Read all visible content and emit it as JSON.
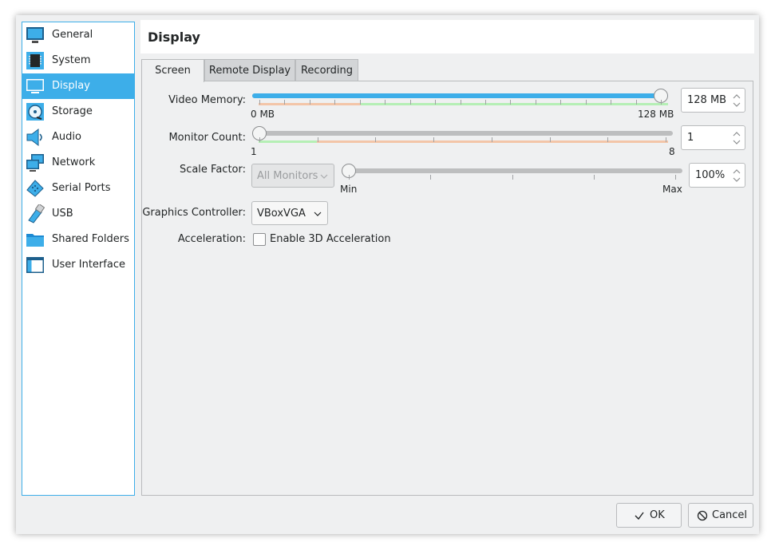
{
  "sidebar": {
    "items": [
      {
        "label": "General",
        "icon": "monitor-general-icon"
      },
      {
        "label": "System",
        "icon": "chip-icon"
      },
      {
        "label": "Display",
        "icon": "display-icon"
      },
      {
        "label": "Storage",
        "icon": "disk-icon"
      },
      {
        "label": "Audio",
        "icon": "speaker-icon"
      },
      {
        "label": "Network",
        "icon": "network-icon"
      },
      {
        "label": "Serial Ports",
        "icon": "serial-port-icon"
      },
      {
        "label": "USB",
        "icon": "usb-icon"
      },
      {
        "label": "Shared Folders",
        "icon": "folder-icon"
      },
      {
        "label": "User Interface",
        "icon": "window-icon"
      }
    ],
    "selected": "Display"
  },
  "header": {
    "title": "Display"
  },
  "tabs": [
    {
      "label": "Screen",
      "active": true
    },
    {
      "label": "Remote Display",
      "active": false
    },
    {
      "label": "Recording",
      "active": false
    }
  ],
  "screen": {
    "video_memory": {
      "label": "Video Memory:",
      "min_label": "0 MB",
      "max_label": "128 MB",
      "value": "128 MB",
      "fraction": 1.0
    },
    "monitor_count": {
      "label": "Monitor Count:",
      "min_label": "1",
      "max_label": "8",
      "value": "1",
      "fraction": 0.0
    },
    "scale_factor": {
      "label": "Scale Factor:",
      "monitor_select": "All Monitors",
      "min_label": "Min",
      "max_label": "Max",
      "value": "100%",
      "fraction": 0.0
    },
    "graphics_controller": {
      "label": "Graphics Controller:",
      "value": "VBoxVGA"
    },
    "acceleration": {
      "label": "Acceleration:",
      "checkbox_label": "Enable 3D Acceleration",
      "checked": false
    }
  },
  "buttons": {
    "ok": "OK",
    "cancel": "Cancel"
  },
  "colors": {
    "accent": "#3daee9",
    "band_green": "#b5efb5",
    "band_orange": "#f3c5a8"
  }
}
